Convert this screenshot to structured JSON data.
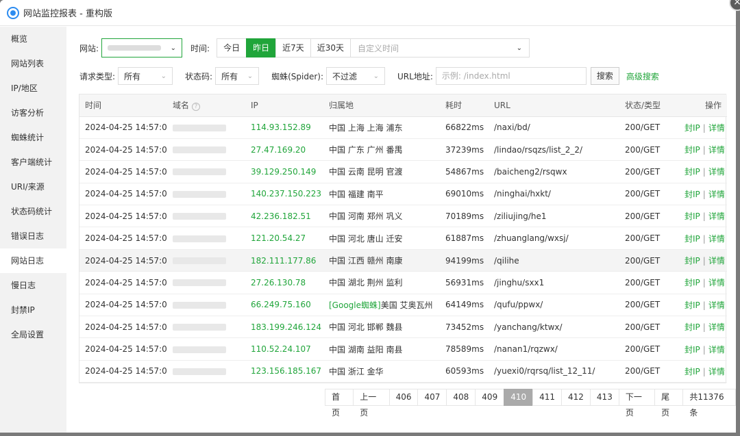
{
  "window": {
    "title": "网站监控报表 - 重构版",
    "close": "×"
  },
  "sidebar": {
    "items": [
      {
        "label": "概览",
        "name": "overview"
      },
      {
        "label": "网站列表",
        "name": "site-list"
      },
      {
        "label": "IP/地区",
        "name": "ip-region"
      },
      {
        "label": "访客分析",
        "name": "visitor-analysis"
      },
      {
        "label": "蜘蛛统计",
        "name": "spider-stats"
      },
      {
        "label": "客户端统计",
        "name": "client-stats"
      },
      {
        "label": "URI/来源",
        "name": "uri-source"
      },
      {
        "label": "状态码统计",
        "name": "status-code-stats"
      },
      {
        "label": "错误日志",
        "name": "error-log"
      },
      {
        "label": "网站日志",
        "name": "site-log"
      },
      {
        "label": "慢日志",
        "name": "slow-log"
      },
      {
        "label": "封禁IP",
        "name": "banned-ip"
      },
      {
        "label": "全局设置",
        "name": "global-settings"
      }
    ],
    "active_index": 9
  },
  "filters": {
    "site_label": "网站:",
    "time_label": "时间:",
    "time_buttons": [
      "今日",
      "昨日",
      "近7天",
      "近30天"
    ],
    "time_active_index": 1,
    "custom_time_placeholder": "自定义时间",
    "request_type_label": "请求类型:",
    "request_type_value": "所有",
    "status_label": "状态码:",
    "status_value": "所有",
    "spider_label": "蜘蛛(Spider):",
    "spider_value": "不过滤",
    "url_label": "URL地址:",
    "url_placeholder": "示例: /index.html",
    "search_button": "搜索",
    "advanced_search": "高级搜索"
  },
  "table": {
    "headers": [
      "时间",
      "域名",
      "IP",
      "归属地",
      "耗时",
      "URL",
      "状态/类型",
      "操作"
    ],
    "ban_label": "封IP",
    "detail_label": "详情",
    "separator": "|",
    "highlight_row": 6,
    "rows": [
      {
        "time": "2024-04-25 14:57:02",
        "ip": "114.93.152.89",
        "location": "中国 上海 上海 浦东",
        "cost": "66822ms",
        "url": "/naxi/bd/",
        "status": "200/GET"
      },
      {
        "time": "2024-04-25 14:57:02",
        "ip": "27.47.169.20",
        "location": "中国 广东 广州 番禺",
        "cost": "37239ms",
        "url": "/lindao/rsqzs/list_2_2/",
        "status": "200/GET"
      },
      {
        "time": "2024-04-25 14:57:02",
        "ip": "39.129.250.149",
        "location": "中国 云南 昆明 官渡",
        "cost": "54867ms",
        "url": "/baicheng2/rsqwx",
        "status": "200/GET"
      },
      {
        "time": "2024-04-25 14:57:02",
        "ip": "140.237.150.223",
        "location": "中国 福建 南平",
        "cost": "69010ms",
        "url": "/ninghai/hxkt/",
        "status": "200/GET"
      },
      {
        "time": "2024-04-25 14:57:01",
        "ip": "42.236.182.51",
        "location": "中国 河南 郑州 巩义",
        "cost": "70189ms",
        "url": "/ziliujing/he1",
        "status": "200/GET"
      },
      {
        "time": "2024-04-25 14:57:01",
        "ip": "121.20.54.27",
        "location": "中国 河北 唐山 迁安",
        "cost": "61887ms",
        "url": "/zhuanglang/wxsj/",
        "status": "200/GET"
      },
      {
        "time": "2024-04-25 14:57:01",
        "ip": "182.111.177.86",
        "location": "中国 江西 赣州 南康",
        "cost": "94199ms",
        "url": "/qilihe",
        "status": "200/GET"
      },
      {
        "time": "2024-04-25 14:57:01",
        "ip": "27.26.130.78",
        "location": "中国 湖北 荆州 监利",
        "cost": "56931ms",
        "url": "/jinghu/sxx1",
        "status": "200/GET"
      },
      {
        "time": "2024-04-25 14:57:01",
        "ip": "66.249.75.160",
        "location": "[Google蜘蛛]美国 艾奥瓦州",
        "location_green_prefix": "[Google蜘蛛]",
        "location_rest": "美国 艾奥瓦州",
        "cost": "64149ms",
        "url": "/qufu/ppwx/",
        "status": "200/GET"
      },
      {
        "time": "2024-04-25 14:57:01",
        "ip": "183.199.246.124",
        "location": "中国 河北 邯郸 魏县",
        "cost": "73452ms",
        "url": "/yanchang/ktwx/",
        "status": "200/GET"
      },
      {
        "time": "2024-04-25 14:57:01",
        "ip": "110.52.24.107",
        "location": "中国 湖南 益阳 南县",
        "cost": "78589ms",
        "url": "/nanan1/rqzwx/",
        "status": "200/GET"
      },
      {
        "time": "2024-04-25 14:57:00",
        "ip": "123.156.185.167",
        "location": "中国 浙江 金华",
        "cost": "60593ms",
        "url": "/yuexi0/rqrsq/list_12_11/",
        "status": "200/GET"
      }
    ]
  },
  "pagination": {
    "first": "首页",
    "prev": "上一页",
    "pages": [
      "406",
      "407",
      "408",
      "409",
      "410",
      "411",
      "412",
      "413"
    ],
    "current": "410",
    "next": "下一页",
    "last": "尾页",
    "total": "共11376条"
  },
  "colors": {
    "accent": "#20a53a",
    "active_page": "#aaaaaa"
  }
}
